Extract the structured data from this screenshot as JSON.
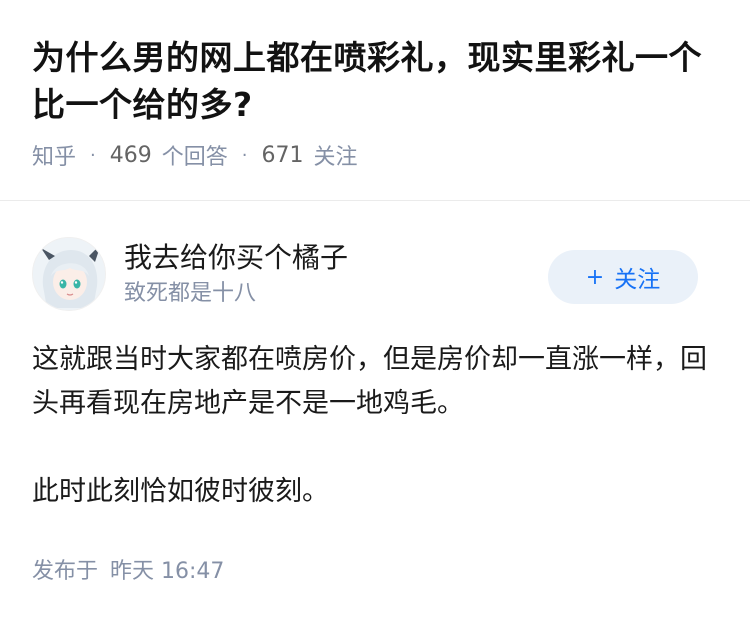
{
  "question": {
    "title": "为什么男的网上都在喷彩礼，现实里彩礼一个比一个给的多?",
    "source": "知乎",
    "answer_count": "469",
    "answer_label": "个回答",
    "follow_count": "671",
    "follow_label": "关注"
  },
  "answer": {
    "author_name": "我去给你买个橘子",
    "author_bio": "致死都是十八",
    "follow_button": {
      "icon": "plus-icon",
      "label": "关注"
    },
    "paragraphs": [
      "这就跟当时大家都在喷房价，但是房价却一直涨一样，回头再看现在房地产是不是一地鸡毛。",
      "此时此刻恰如彼时彼刻。"
    ],
    "publish_label": "发布于",
    "publish_time": "昨天 16:47"
  },
  "colors": {
    "accent": "#1772f6",
    "button_bg": "#eaf1f9",
    "meta_text": "#8590a6"
  }
}
